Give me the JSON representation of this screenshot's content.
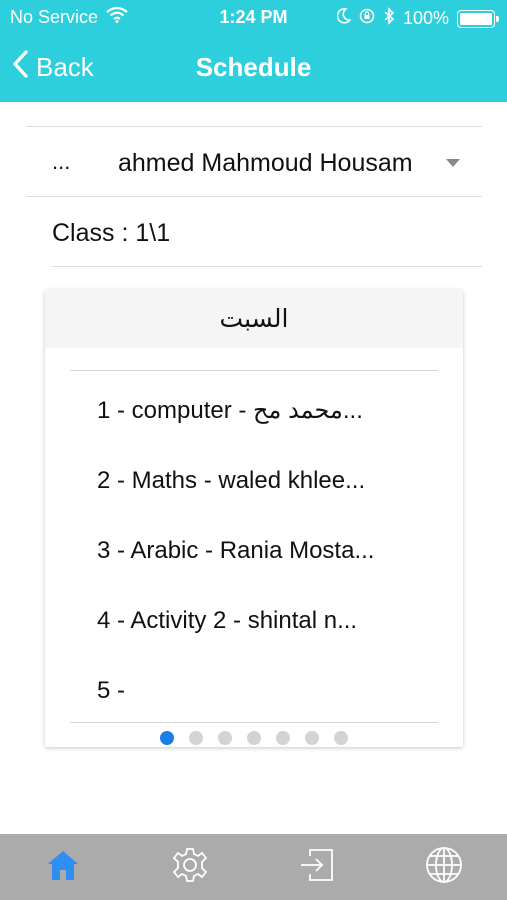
{
  "status_bar": {
    "carrier": "No Service",
    "time": "1:24 PM",
    "battery": "100%",
    "battery_level": 1.0
  },
  "nav": {
    "back_label": "Back",
    "title": "Schedule"
  },
  "student": {
    "more_label": "...",
    "name": "ahmed Mahmoud Housam"
  },
  "class_label": "Class : 1\\1",
  "day": {
    "title": "السبت",
    "periods": [
      "1 - computer - محمد مح...",
      "2 - Maths - waled khlee...",
      "3 - Arabic - Rania Mosta...",
      "4 - Activity 2 - shintal n...",
      "5 -"
    ],
    "page_count": 7,
    "current_page": 1
  },
  "tab_bar": {
    "items": [
      "home-icon",
      "settings-icon",
      "logout-icon",
      "language-icon"
    ],
    "active": "home-icon"
  },
  "colors": {
    "header": "#2ccfdb",
    "tab_bar": "#ababab",
    "active_tab": "#2f8ef2",
    "active_dot": "#1a7de8"
  }
}
